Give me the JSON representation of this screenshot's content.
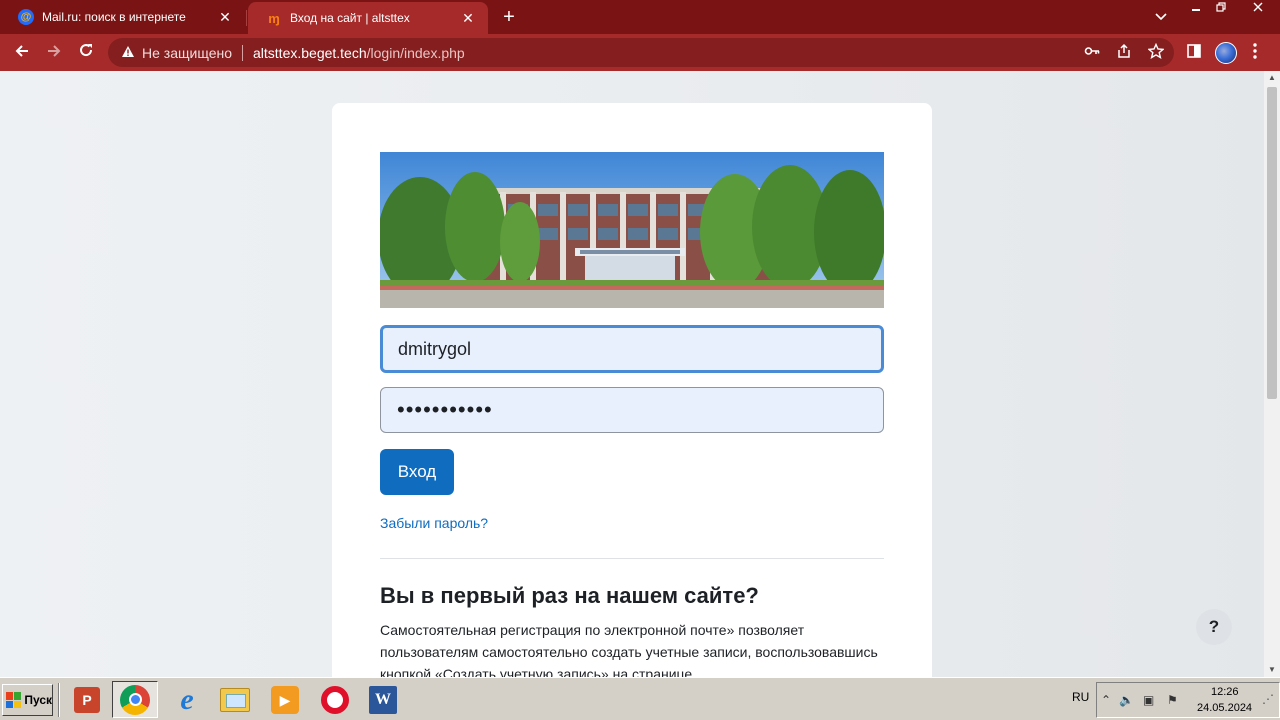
{
  "browser": {
    "tabs": [
      {
        "title": "Mail.ru: поиск в интернете",
        "favicon": "mailru-icon",
        "active": false
      },
      {
        "title": "Вход на сайт | altsttex",
        "favicon": "moodle-icon",
        "active": true
      }
    ],
    "tab_close_glyph": "✕",
    "new_tab_glyph": "+",
    "address": {
      "security_text": "Не защищено",
      "host": "altsttex.beget.tech",
      "path": "/login/index.php"
    }
  },
  "login_page": {
    "username_value": "dmitrygol",
    "password_mask": "•••••••••••",
    "login_button": "Вход",
    "forgot_link": "Забыли пароль?",
    "first_time_heading": "Вы в первый раз на нашем сайте?",
    "first_time_text": "Самостоятельная регистрация по электронной почте» позволяет пользователям самостоятельно создать учетные записи, воспользовавшись кнопкой «Создать учетную запись» на странице",
    "help_button": "?"
  },
  "taskbar": {
    "start_label": "Пуск",
    "apps": [
      "powerpoint-icon",
      "chrome-icon",
      "internet-explorer-icon",
      "explorer-folder-icon",
      "media-player-icon",
      "opera-icon",
      "word-icon"
    ],
    "language": "RU",
    "time": "12:26",
    "date": "24.05.2024"
  },
  "colors": {
    "tab_strip": "#7a1414",
    "toolbar": "#a62a2a",
    "primary_button": "#0f6cbf",
    "link": "#0f6cbf"
  }
}
